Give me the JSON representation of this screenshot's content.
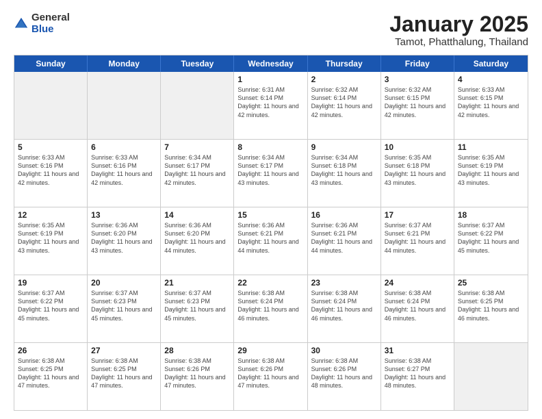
{
  "logo": {
    "general": "General",
    "blue": "Blue"
  },
  "title": "January 2025",
  "subtitle": "Tamot, Phatthalung, Thailand",
  "weekdays": [
    "Sunday",
    "Monday",
    "Tuesday",
    "Wednesday",
    "Thursday",
    "Friday",
    "Saturday"
  ],
  "weeks": [
    [
      {
        "day": "",
        "info": "",
        "empty": true
      },
      {
        "day": "",
        "info": "",
        "empty": true
      },
      {
        "day": "",
        "info": "",
        "empty": true
      },
      {
        "day": "1",
        "info": "Sunrise: 6:31 AM\nSunset: 6:14 PM\nDaylight: 11 hours\nand 42 minutes."
      },
      {
        "day": "2",
        "info": "Sunrise: 6:32 AM\nSunset: 6:14 PM\nDaylight: 11 hours\nand 42 minutes."
      },
      {
        "day": "3",
        "info": "Sunrise: 6:32 AM\nSunset: 6:15 PM\nDaylight: 11 hours\nand 42 minutes."
      },
      {
        "day": "4",
        "info": "Sunrise: 6:33 AM\nSunset: 6:15 PM\nDaylight: 11 hours\nand 42 minutes."
      }
    ],
    [
      {
        "day": "5",
        "info": "Sunrise: 6:33 AM\nSunset: 6:16 PM\nDaylight: 11 hours\nand 42 minutes."
      },
      {
        "day": "6",
        "info": "Sunrise: 6:33 AM\nSunset: 6:16 PM\nDaylight: 11 hours\nand 42 minutes."
      },
      {
        "day": "7",
        "info": "Sunrise: 6:34 AM\nSunset: 6:17 PM\nDaylight: 11 hours\nand 42 minutes."
      },
      {
        "day": "8",
        "info": "Sunrise: 6:34 AM\nSunset: 6:17 PM\nDaylight: 11 hours\nand 43 minutes."
      },
      {
        "day": "9",
        "info": "Sunrise: 6:34 AM\nSunset: 6:18 PM\nDaylight: 11 hours\nand 43 minutes."
      },
      {
        "day": "10",
        "info": "Sunrise: 6:35 AM\nSunset: 6:18 PM\nDaylight: 11 hours\nand 43 minutes."
      },
      {
        "day": "11",
        "info": "Sunrise: 6:35 AM\nSunset: 6:19 PM\nDaylight: 11 hours\nand 43 minutes."
      }
    ],
    [
      {
        "day": "12",
        "info": "Sunrise: 6:35 AM\nSunset: 6:19 PM\nDaylight: 11 hours\nand 43 minutes."
      },
      {
        "day": "13",
        "info": "Sunrise: 6:36 AM\nSunset: 6:20 PM\nDaylight: 11 hours\nand 43 minutes."
      },
      {
        "day": "14",
        "info": "Sunrise: 6:36 AM\nSunset: 6:20 PM\nDaylight: 11 hours\nand 44 minutes."
      },
      {
        "day": "15",
        "info": "Sunrise: 6:36 AM\nSunset: 6:21 PM\nDaylight: 11 hours\nand 44 minutes."
      },
      {
        "day": "16",
        "info": "Sunrise: 6:36 AM\nSunset: 6:21 PM\nDaylight: 11 hours\nand 44 minutes."
      },
      {
        "day": "17",
        "info": "Sunrise: 6:37 AM\nSunset: 6:21 PM\nDaylight: 11 hours\nand 44 minutes."
      },
      {
        "day": "18",
        "info": "Sunrise: 6:37 AM\nSunset: 6:22 PM\nDaylight: 11 hours\nand 45 minutes."
      }
    ],
    [
      {
        "day": "19",
        "info": "Sunrise: 6:37 AM\nSunset: 6:22 PM\nDaylight: 11 hours\nand 45 minutes."
      },
      {
        "day": "20",
        "info": "Sunrise: 6:37 AM\nSunset: 6:23 PM\nDaylight: 11 hours\nand 45 minutes."
      },
      {
        "day": "21",
        "info": "Sunrise: 6:37 AM\nSunset: 6:23 PM\nDaylight: 11 hours\nand 45 minutes."
      },
      {
        "day": "22",
        "info": "Sunrise: 6:38 AM\nSunset: 6:24 PM\nDaylight: 11 hours\nand 46 minutes."
      },
      {
        "day": "23",
        "info": "Sunrise: 6:38 AM\nSunset: 6:24 PM\nDaylight: 11 hours\nand 46 minutes."
      },
      {
        "day": "24",
        "info": "Sunrise: 6:38 AM\nSunset: 6:24 PM\nDaylight: 11 hours\nand 46 minutes."
      },
      {
        "day": "25",
        "info": "Sunrise: 6:38 AM\nSunset: 6:25 PM\nDaylight: 11 hours\nand 46 minutes."
      }
    ],
    [
      {
        "day": "26",
        "info": "Sunrise: 6:38 AM\nSunset: 6:25 PM\nDaylight: 11 hours\nand 47 minutes."
      },
      {
        "day": "27",
        "info": "Sunrise: 6:38 AM\nSunset: 6:25 PM\nDaylight: 11 hours\nand 47 minutes."
      },
      {
        "day": "28",
        "info": "Sunrise: 6:38 AM\nSunset: 6:26 PM\nDaylight: 11 hours\nand 47 minutes."
      },
      {
        "day": "29",
        "info": "Sunrise: 6:38 AM\nSunset: 6:26 PM\nDaylight: 11 hours\nand 47 minutes."
      },
      {
        "day": "30",
        "info": "Sunrise: 6:38 AM\nSunset: 6:26 PM\nDaylight: 11 hours\nand 48 minutes."
      },
      {
        "day": "31",
        "info": "Sunrise: 6:38 AM\nSunset: 6:27 PM\nDaylight: 11 hours\nand 48 minutes."
      },
      {
        "day": "",
        "info": "",
        "empty": true
      }
    ]
  ]
}
